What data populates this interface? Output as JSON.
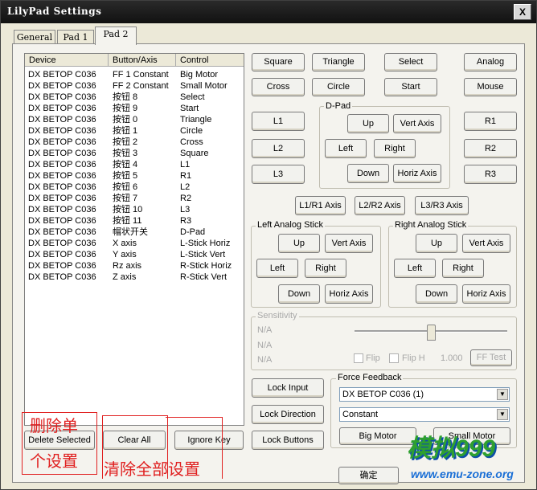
{
  "window": {
    "title": "LilyPad Settings",
    "close_glyph": "X"
  },
  "tabs": [
    {
      "label": "General"
    },
    {
      "label": "Pad 1"
    },
    {
      "label": "Pad 2",
      "active": true
    }
  ],
  "binding_list": {
    "columns": [
      "Device",
      "Button/Axis",
      "Control"
    ],
    "rows": [
      [
        "DX BETOP C036",
        "FF 1 Constant",
        "Big Motor"
      ],
      [
        "DX BETOP C036",
        "FF 2 Constant",
        "Small Motor"
      ],
      [
        "DX BETOP C036",
        "按钮 8",
        "Select"
      ],
      [
        "DX BETOP C036",
        "按钮 9",
        "Start"
      ],
      [
        "DX BETOP C036",
        "按钮 0",
        "Triangle"
      ],
      [
        "DX BETOP C036",
        "按钮 1",
        "Circle"
      ],
      [
        "DX BETOP C036",
        "按钮 2",
        "Cross"
      ],
      [
        "DX BETOP C036",
        "按钮 3",
        "Square"
      ],
      [
        "DX BETOP C036",
        "按钮 4",
        "L1"
      ],
      [
        "DX BETOP C036",
        "按钮 5",
        "R1"
      ],
      [
        "DX BETOP C036",
        "按钮 6",
        "L2"
      ],
      [
        "DX BETOP C036",
        "按钮 7",
        "R2"
      ],
      [
        "DX BETOP C036",
        "按钮 10",
        "L3"
      ],
      [
        "DX BETOP C036",
        "按钮 11",
        "R3"
      ],
      [
        "DX BETOP C036",
        "帽状开关",
        "D-Pad"
      ],
      [
        "DX BETOP C036",
        "X axis",
        "L-Stick Horiz"
      ],
      [
        "DX BETOP C036",
        "Y axis",
        "L-Stick Vert"
      ],
      [
        "DX BETOP C036",
        "Rz axis",
        "R-Stick Horiz"
      ],
      [
        "DX BETOP C036",
        "Z axis",
        "R-Stick Vert"
      ]
    ]
  },
  "buttons": {
    "square": "Square",
    "triangle": "Triangle",
    "select": "Select",
    "analog": "Analog",
    "cross": "Cross",
    "circle": "Circle",
    "start": "Start",
    "mouse": "Mouse",
    "l1": "L1",
    "l2": "L2",
    "l3": "L3",
    "r1": "R1",
    "r2": "R2",
    "r3": "R3",
    "l1r1_axis": "L1/R1 Axis",
    "l2r2_axis": "L2/R2 Axis",
    "l3r3_axis": "L3/R3 Axis",
    "delete_selected": "Delete Selected",
    "clear_all": "Clear All",
    "ignore_key": "Ignore Key",
    "lock_input": "Lock Input",
    "lock_direction": "Lock Direction",
    "lock_buttons": "Lock Buttons",
    "ok": "确定"
  },
  "dpad": {
    "label": "D-Pad",
    "up": "Up",
    "down": "Down",
    "left": "Left",
    "right": "Right",
    "vert_axis": "Vert Axis",
    "horiz_axis": "Horiz Axis"
  },
  "left_stick": {
    "label": "Left Analog Stick",
    "up": "Up",
    "down": "Down",
    "left": "Left",
    "right": "Right",
    "vert_axis": "Vert Axis",
    "horiz_axis": "Horiz Axis"
  },
  "right_stick": {
    "label": "Right Analog Stick",
    "up": "Up",
    "down": "Down",
    "left": "Left",
    "right": "Right",
    "vert_axis": "Vert Axis",
    "horiz_axis": "Horiz Axis"
  },
  "sensitivity": {
    "label": "Sensitivity",
    "na": [
      "N/A",
      "N/A",
      "N/A"
    ],
    "flip": "Flip",
    "flip_h": "Flip H",
    "value": "1.000",
    "slider_fraction": 0.5,
    "ff_test": "FF Test"
  },
  "force_feedback": {
    "label": "Force Feedback",
    "device": "DX BETOP C036 (1)",
    "effect": "Constant",
    "big_motor": "Big Motor",
    "small_motor": "Small Motor"
  },
  "annotations": {
    "delete_cn_line1": "删除单",
    "delete_cn_line2": "个设置",
    "clear_cn": "清除全部设置"
  },
  "watermark": {
    "logo": "模拟999",
    "url": "www.emu-zone.org"
  },
  "colors": {
    "annotation_red": "#e02020",
    "watermark_green": "#2fa02f",
    "watermark_blue": "#1a6fd6"
  }
}
